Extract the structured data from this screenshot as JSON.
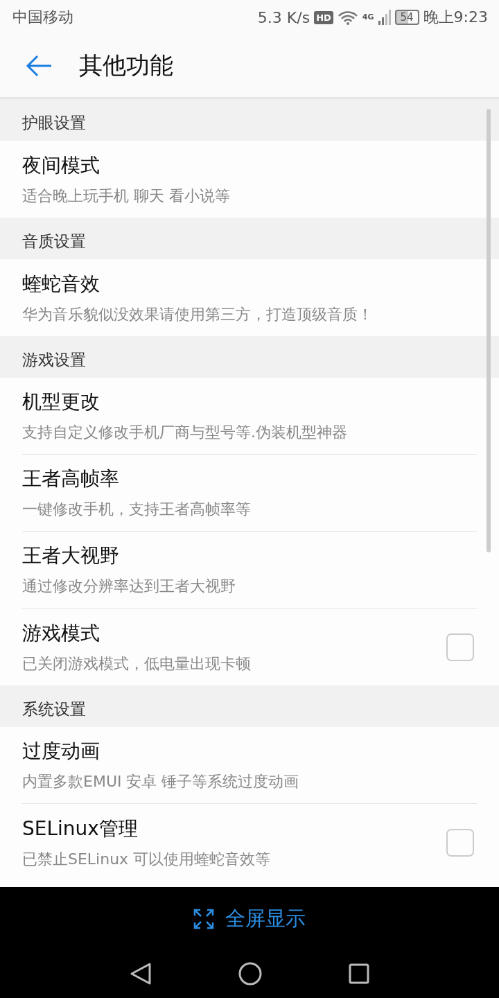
{
  "status_bar": {
    "carrier": "中国移动",
    "speed": "5.3 K/s",
    "hd": "HD",
    "network": "4G",
    "battery": "54",
    "time": "晚上9:23"
  },
  "header": {
    "title": "其他功能"
  },
  "sections": [
    {
      "title": "护眼设置",
      "items": [
        {
          "kind": "plain",
          "title": "夜间模式",
          "subtitle": "适合晚上玩手机 聊天 看小说等"
        }
      ]
    },
    {
      "title": "音质设置",
      "items": [
        {
          "kind": "plain",
          "title": "蝰蛇音效",
          "subtitle": "华为音乐貌似没效果请使用第三方，打造顶级音质！"
        }
      ]
    },
    {
      "title": "游戏设置",
      "items": [
        {
          "kind": "plain",
          "title": "机型更改",
          "subtitle": "支持自定义修改手机厂商与型号等.伪装机型神器"
        },
        {
          "kind": "plain",
          "title": "王者高帧率",
          "subtitle": "一键修改手机，支持王者高帧率等"
        },
        {
          "kind": "plain",
          "title": "王者大视野",
          "subtitle": "通过修改分辨率达到王者大视野"
        },
        {
          "kind": "checkbox",
          "checked": false,
          "title": "游戏模式",
          "subtitle": "已关闭游戏模式，低电量出现卡顿"
        }
      ]
    },
    {
      "title": "系统设置",
      "items": [
        {
          "kind": "plain",
          "title": "过度动画",
          "subtitle": "内置多款EMUI 安卓 锤子等系统过度动画"
        },
        {
          "kind": "checkbox",
          "checked": false,
          "title": "SELinux管理",
          "subtitle": "已禁止SELinux 可以使用蝰蛇音效等"
        }
      ]
    }
  ],
  "fullscreen_button": "全屏显示"
}
